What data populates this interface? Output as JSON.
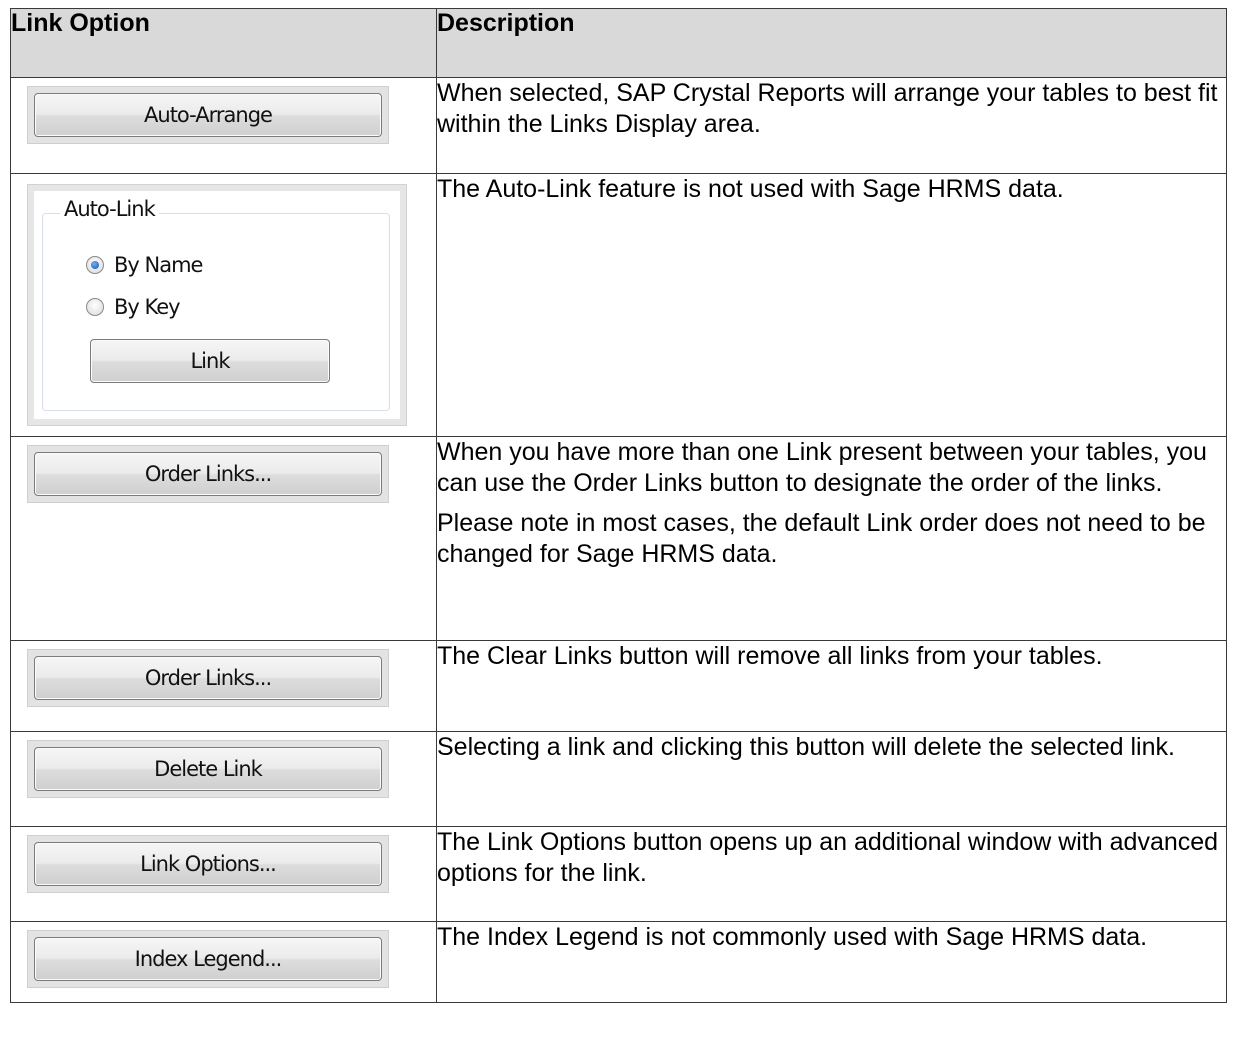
{
  "table": {
    "headers": {
      "option": "Link Option",
      "description": "Description"
    },
    "rows": [
      {
        "button": "Auto-Arrange",
        "description": [
          "When selected, SAP Crystal Reports will arrange your tables to best fit within the Links Display area."
        ]
      },
      {
        "group": {
          "legend": "Auto-Link",
          "radio_by_name": "By Name",
          "radio_by_key": "By Key",
          "selected": "By Name",
          "button": "Link"
        },
        "description": [
          "The Auto-Link feature is not used with Sage HRMS data."
        ]
      },
      {
        "button": "Order Links...",
        "description": [
          "When you have more than one Link present between your tables, you can use the Order Links button to designate the order of the links.",
          "Please note in most cases, the default Link order does not need to be changed for Sage HRMS data."
        ]
      },
      {
        "button": "Order Links...",
        "description": [
          "The Clear Links button will remove all links from your tables."
        ]
      },
      {
        "button": "Delete Link",
        "description": [
          "Selecting a link and clicking this button will delete the selected link."
        ]
      },
      {
        "button": "Link Options...",
        "description": [
          "The Link Options button opens up an additional window with advanced options for the link."
        ]
      },
      {
        "button": "Index Legend...",
        "description": [
          "The Index Legend is not commonly used with Sage HRMS data."
        ]
      }
    ]
  }
}
